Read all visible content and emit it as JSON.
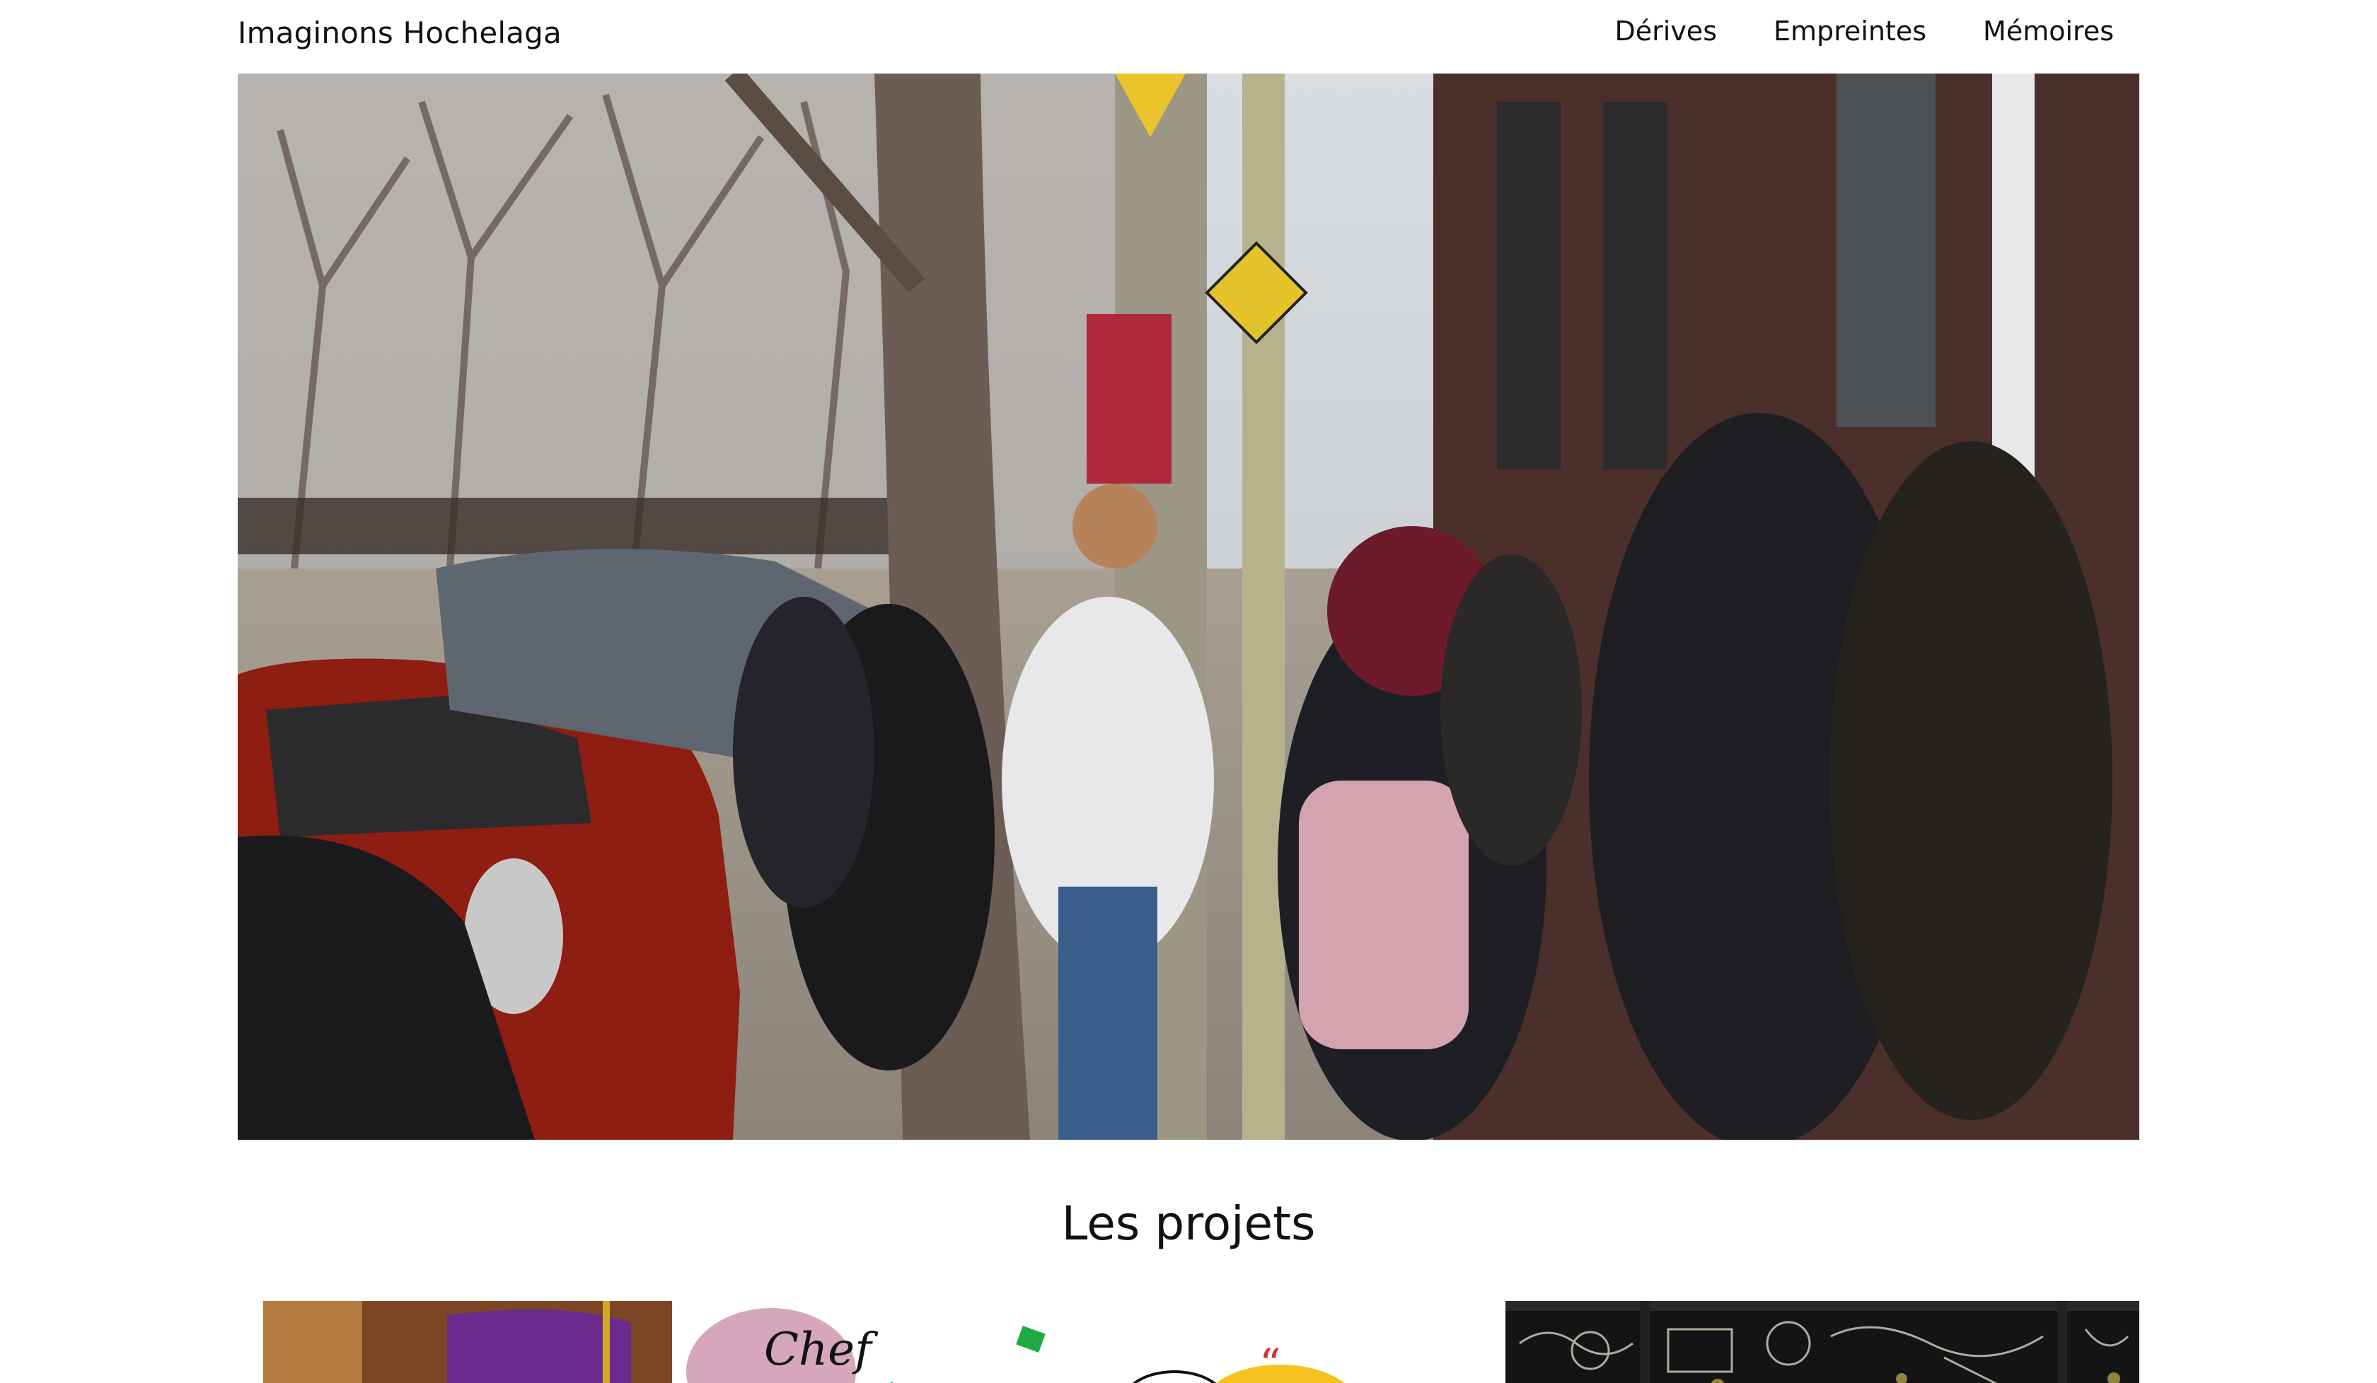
{
  "header": {
    "site_title": "Imaginons Hochelaga",
    "nav": [
      {
        "label": "Dérives"
      },
      {
        "label": "Empreintes"
      },
      {
        "label": "Mémoires"
      }
    ]
  },
  "hero": {
    "subject": "street scene"
  },
  "projects": {
    "title": "Les projets",
    "cards": [
      {
        "name": "project-card-1"
      },
      {
        "name": "project-card-2",
        "text": "Chef"
      },
      {
        "name": "project-card-3"
      }
    ]
  },
  "colors": {
    "background": "#ffffff",
    "text": "#111111"
  }
}
